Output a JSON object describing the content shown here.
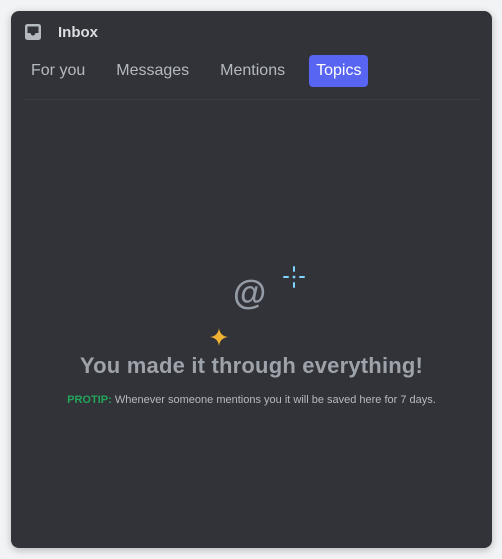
{
  "header": {
    "title": "Inbox",
    "icon": "inbox-icon"
  },
  "tabs": [
    {
      "label": "For you",
      "active": false
    },
    {
      "label": "Messages",
      "active": false
    },
    {
      "label": "Mentions",
      "active": false
    },
    {
      "label": "Topics",
      "active": true
    }
  ],
  "empty_state": {
    "icon": "at-sign-icon",
    "at_symbol": "@",
    "title": "You made it through everything!",
    "protip_label": "PROTIP:",
    "protip_text": " Whenever someone mentions you it will be saved here for 7 days."
  },
  "colors": {
    "panel_bg": "#313338",
    "accent": "#5865f2",
    "protip_green": "#23a55a",
    "sparkle_yellow": "#f0b232",
    "sparkle_blue": "#00a8fc"
  }
}
